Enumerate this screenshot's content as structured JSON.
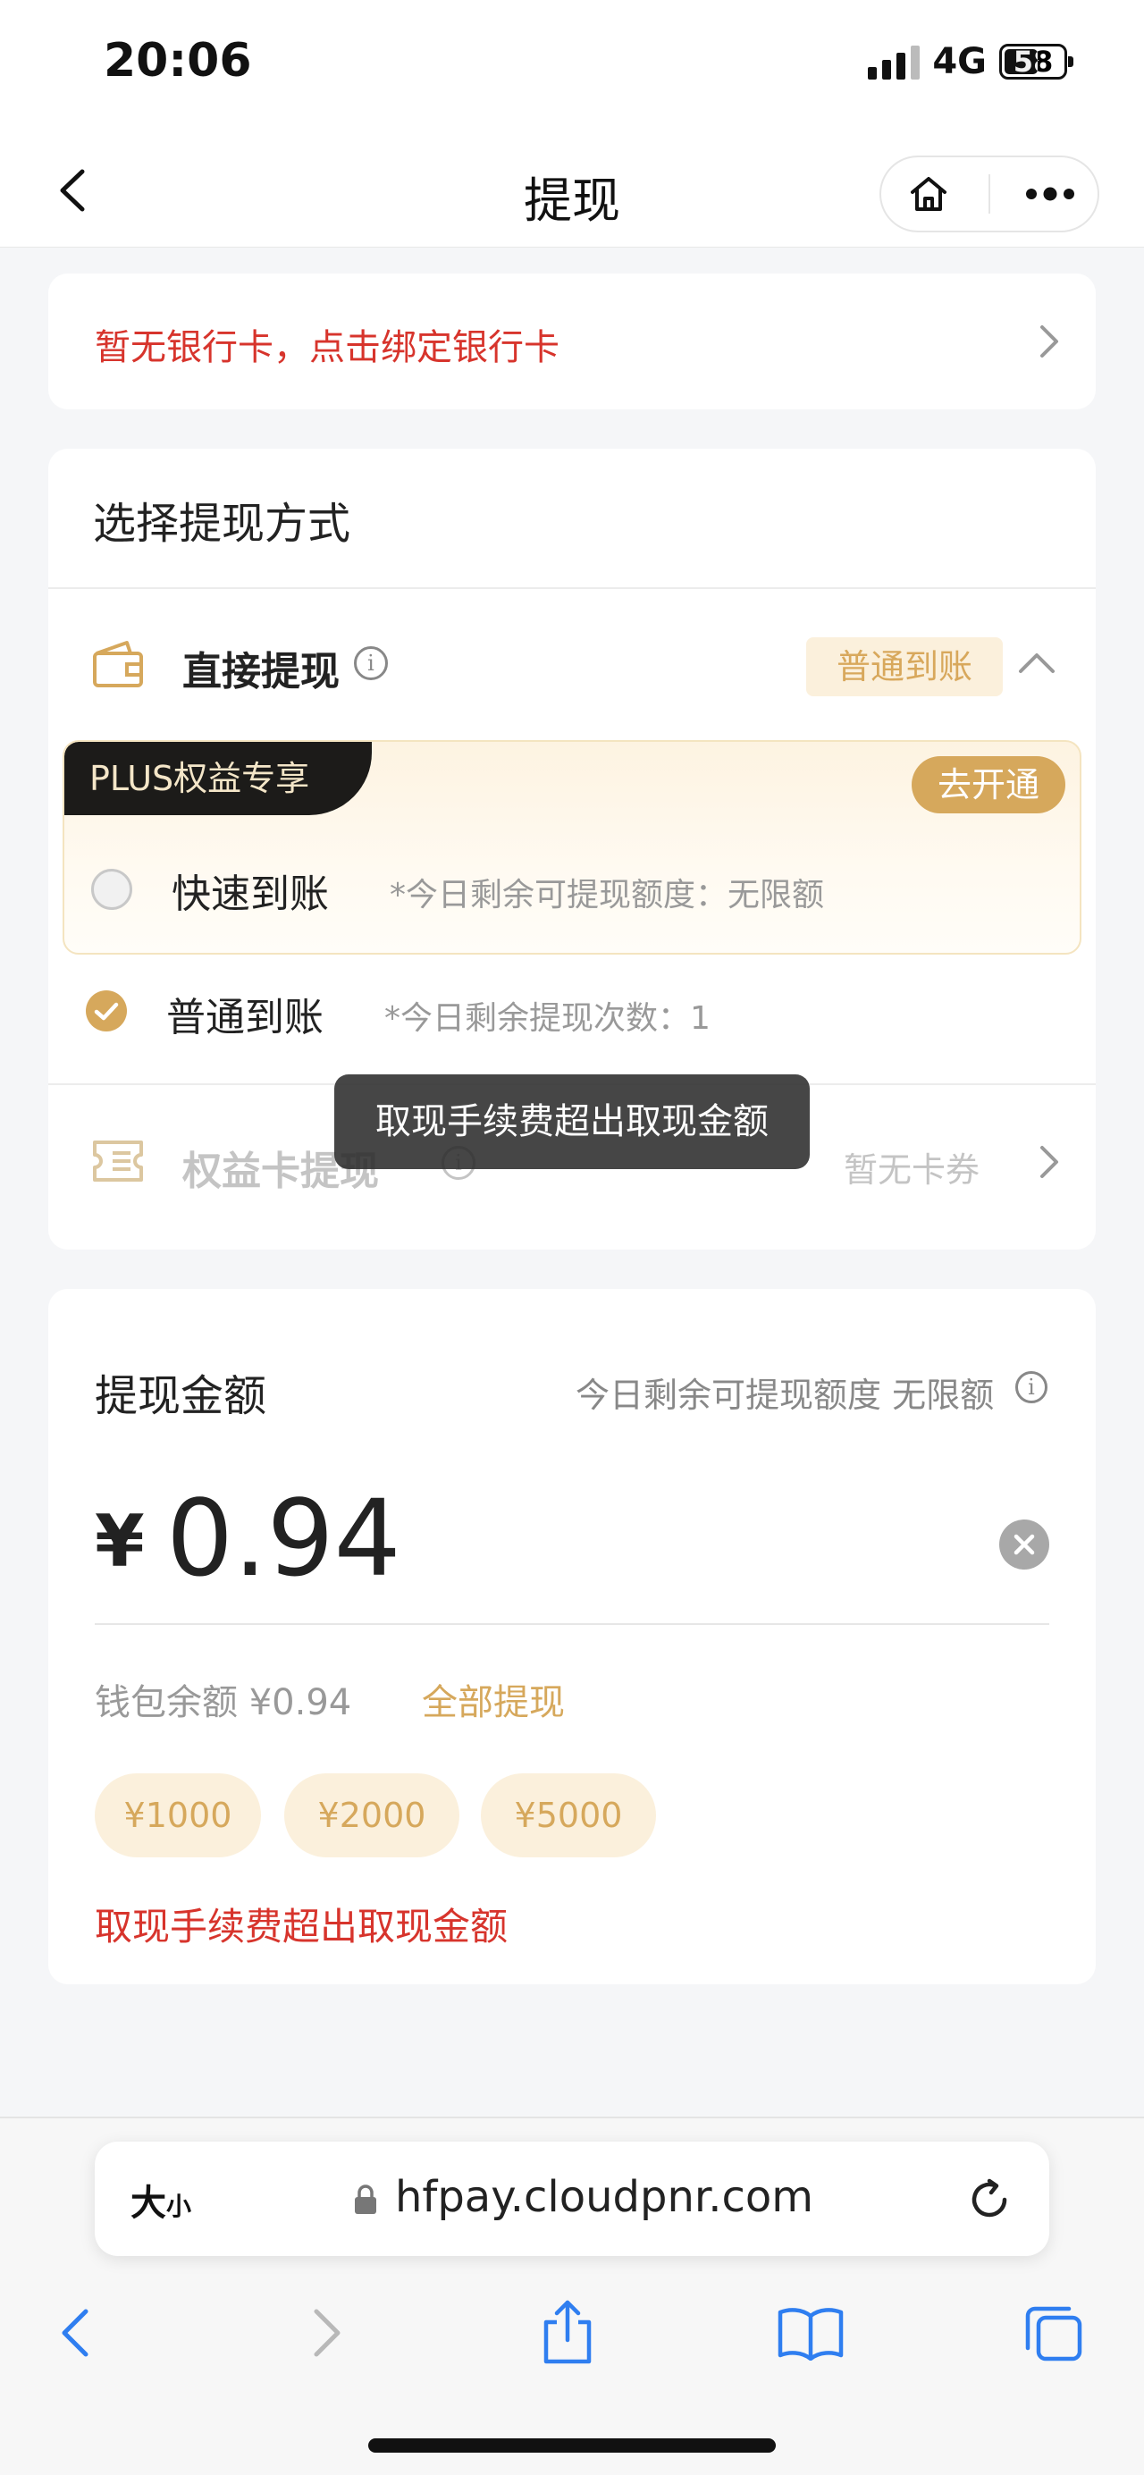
{
  "status_bar": {
    "time": "20:06",
    "network": "4G",
    "battery": "58",
    "battery_level_percent": 58
  },
  "nav": {
    "title": "提现",
    "back_icon": "chevron-left-icon",
    "home_icon": "home-icon",
    "more_icon": "more-dots-icon"
  },
  "bank_card": {
    "text": "暂无银行卡，点击绑定银行卡",
    "color": "#d7342c"
  },
  "method": {
    "title": "选择提现方式",
    "direct": {
      "label": "直接提现",
      "badge": "普通到账"
    },
    "plus": {
      "tag": "PLUS权益专享",
      "open_button": "去开通",
      "fast_label": "快速到账",
      "fast_hint": "*今日剩余可提现额度：无限额",
      "fast_selected": false
    },
    "normal": {
      "label": "普通到账",
      "hint": "*今日剩余提现次数：1",
      "selected": true
    },
    "card": {
      "label": "权益卡提现",
      "status": "暂无卡券"
    }
  },
  "toast": {
    "text": "取现手续费超出取现金额"
  },
  "amount": {
    "title": "提现金额",
    "limit": "今日剩余可提现额度 无限额",
    "currency": "¥",
    "value": "0.94",
    "balance": "钱包余额 ¥0.94",
    "withdraw_all": "全部提现",
    "chips": [
      "¥1000",
      "¥2000",
      "¥5000"
    ],
    "error": "取现手续费超出取现金额"
  },
  "browser": {
    "size_label_big": "大",
    "size_label_small": "小",
    "url": "hfpay.cloudpnr.com"
  },
  "colors": {
    "accent_gold": "#d6a85c",
    "error_red": "#d7342c",
    "link_blue": "#2f7ef0"
  }
}
